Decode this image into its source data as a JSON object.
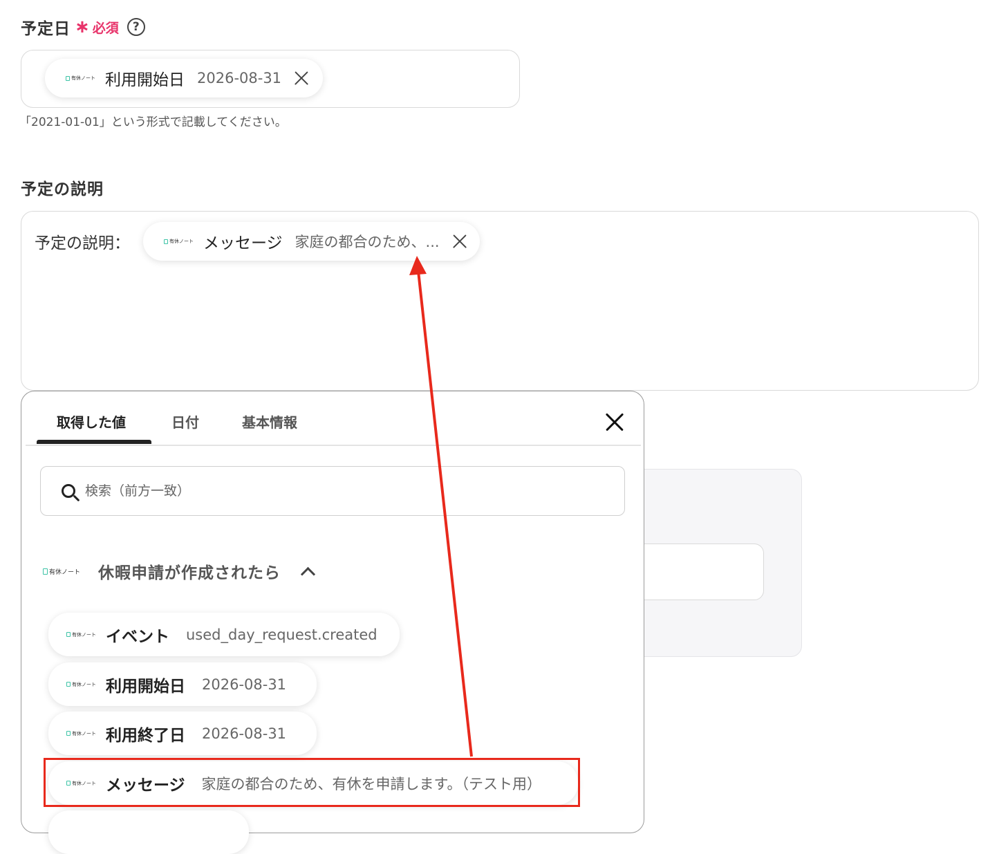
{
  "date_field": {
    "label": "予定日",
    "required_mark": "∗",
    "required_text": "必須",
    "help_icon": "?",
    "token": {
      "app": "有休ノート",
      "key": "利用開始日",
      "value": "2026-08-31"
    },
    "hint": "「2021-01-01」という形式で記載してください。"
  },
  "desc_field": {
    "label": "予定の説明",
    "prefix": "予定の説明：",
    "token": {
      "app": "有休ノート",
      "key": "メッセージ",
      "value": "家庭の都合のため、..."
    }
  },
  "panel": {
    "tabs": [
      {
        "label": "取得した値",
        "active": true
      },
      {
        "label": "日付",
        "active": false
      },
      {
        "label": "基本情報",
        "active": false
      }
    ],
    "search_placeholder": "検索（前方一致）",
    "group": {
      "app": "有休ノート",
      "title": "休暇申請が作成されたら"
    },
    "items": [
      {
        "app": "有休ノート",
        "key": "イベント",
        "value": "used_day_request.created"
      },
      {
        "app": "有休ノート",
        "key": "利用開始日",
        "value": "2026-08-31"
      },
      {
        "app": "有休ノート",
        "key": "利用終了日",
        "value": "2026-08-31"
      },
      {
        "app": "有休ノート",
        "key": "メッセージ",
        "value": "家庭の都合のため、有休を申請します。（テスト用）"
      }
    ]
  },
  "colors": {
    "accent_red": "#e8291c",
    "required_pink": "#e8336a",
    "logo_teal": "#3cc3a6"
  }
}
